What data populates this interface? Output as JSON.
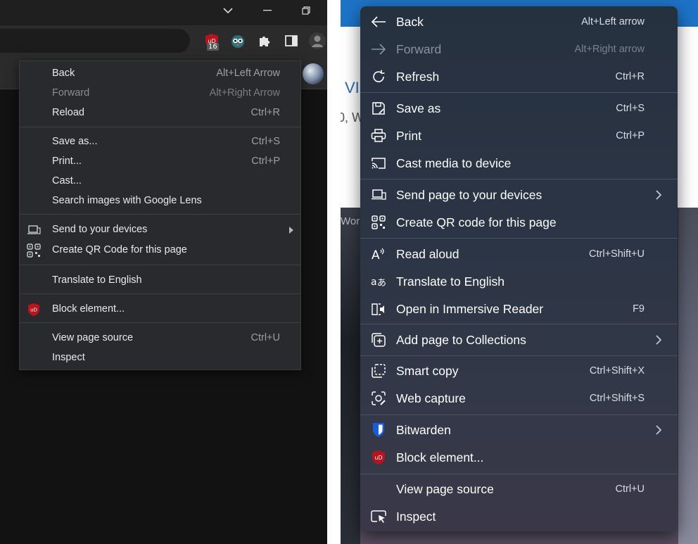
{
  "chrome": {
    "ublock_badge": "16",
    "menu": {
      "group1": [
        {
          "label": "Back",
          "shortcut": "Alt+Left Arrow",
          "disabled": false
        },
        {
          "label": "Forward",
          "shortcut": "Alt+Right Arrow",
          "disabled": true
        },
        {
          "label": "Reload",
          "shortcut": "Ctrl+R",
          "disabled": false
        }
      ],
      "group2": [
        {
          "label": "Save as...",
          "shortcut": "Ctrl+S"
        },
        {
          "label": "Print...",
          "shortcut": "Ctrl+P"
        },
        {
          "label": "Cast...",
          "shortcut": ""
        },
        {
          "label": "Search images with Google Lens",
          "shortcut": ""
        }
      ],
      "group3": [
        {
          "label": "Send to your devices",
          "icon": "laptop-icon",
          "submenu": true
        },
        {
          "label": "Create QR Code for this page",
          "icon": "qr-code-icon"
        }
      ],
      "group4": [
        {
          "label": "Translate to English"
        }
      ],
      "group5": [
        {
          "label": "Block element...",
          "icon": "ublock-shield-icon"
        }
      ],
      "group6": [
        {
          "label": "View page source",
          "shortcut": "Ctrl+U"
        },
        {
          "label": "Inspect",
          "shortcut": ""
        }
      ]
    }
  },
  "edge": {
    "background": {
      "letter_v": "VI",
      "text_w": "0, W",
      "text_wor": "Wor"
    },
    "menu": {
      "items": [
        {
          "label": "Back",
          "shortcut": "Alt+Left arrow",
          "icon": "arrow-left-icon"
        },
        {
          "label": "Forward",
          "shortcut": "Alt+Right arrow",
          "icon": "arrow-right-icon",
          "disabled": true
        },
        {
          "label": "Refresh",
          "shortcut": "Ctrl+R",
          "icon": "refresh-icon"
        },
        {
          "label": "Save as",
          "shortcut": "Ctrl+S",
          "icon": "save-icon"
        },
        {
          "label": "Print",
          "shortcut": "Ctrl+P",
          "icon": "printer-icon"
        },
        {
          "label": "Cast media to device",
          "shortcut": "",
          "icon": "cast-icon"
        },
        {
          "label": "Send page to your devices",
          "shortcut": "",
          "icon": "laptop-icon",
          "submenu": true
        },
        {
          "label": "Create QR code for this page",
          "shortcut": "",
          "icon": "qr-code-icon"
        },
        {
          "label": "Read aloud",
          "shortcut": "Ctrl+Shift+U",
          "icon": "read-aloud-icon"
        },
        {
          "label": "Translate to English",
          "shortcut": "",
          "icon": "translate-icon"
        },
        {
          "label": "Open in Immersive Reader",
          "shortcut": "F9",
          "icon": "immersive-reader-icon"
        },
        {
          "label": "Add page to Collections",
          "shortcut": "",
          "icon": "collections-icon",
          "submenu": true
        },
        {
          "label": "Smart copy",
          "shortcut": "Ctrl+Shift+X",
          "icon": "smart-copy-icon"
        },
        {
          "label": "Web capture",
          "shortcut": "Ctrl+Shift+S",
          "icon": "web-capture-icon"
        },
        {
          "label": "Bitwarden",
          "shortcut": "",
          "icon": "bitwarden-shield-icon",
          "submenu": true
        },
        {
          "label": "Block element...",
          "shortcut": "",
          "icon": "ublock-shield-icon"
        },
        {
          "label": "View page source",
          "shortcut": "Ctrl+U",
          "icon": ""
        },
        {
          "label": "Inspect",
          "shortcut": "",
          "icon": "inspect-icon"
        }
      ]
    }
  },
  "colors": {
    "chrome_menu_bg": "#292a2d",
    "edge_menu_bg": "#2c3545",
    "edge_accent_blue": "#1e73c7",
    "ublock_red": "#b8141e",
    "bitwarden_blue": "#175ddc"
  }
}
